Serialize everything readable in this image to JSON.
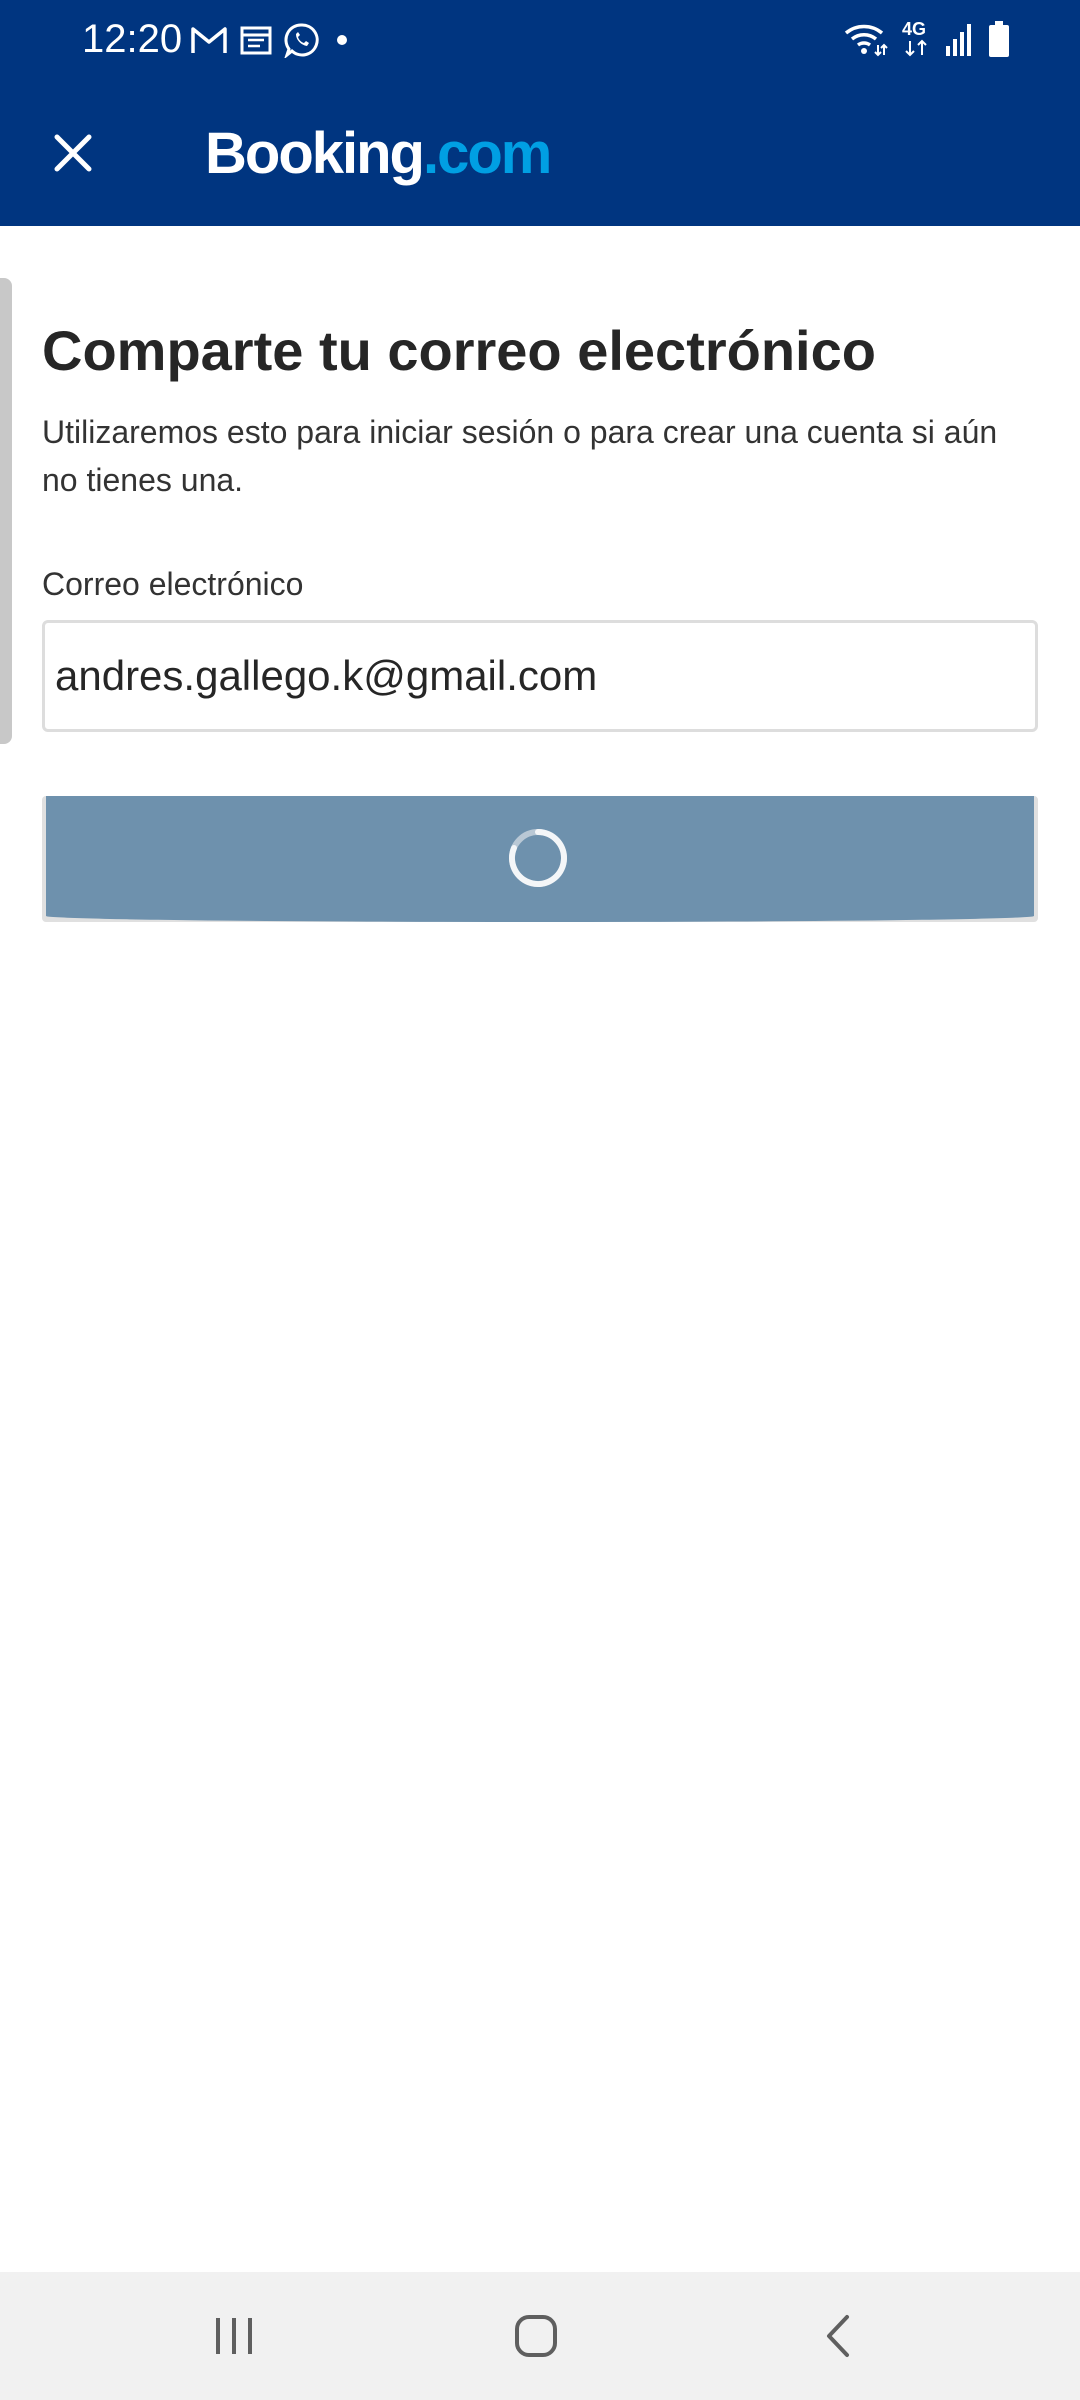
{
  "status_bar": {
    "time": "12:20",
    "left_icons": [
      "gmail-icon",
      "calendar-icon",
      "whatsapp-icon",
      "notification-dot-icon"
    ],
    "network_label": "4G",
    "right_icons": [
      "wifi-icon",
      "mobile-data-icon",
      "signal-icon",
      "battery-icon"
    ]
  },
  "app_bar": {
    "close_icon": "close-icon",
    "logo_main": "Booking",
    "logo_tld": ".com",
    "colors": {
      "background": "#003580",
      "logo_tld": "#009fe3"
    }
  },
  "main": {
    "title": "Comparte tu correo electrónico",
    "subtitle": "Utilizaremos esto para iniciar sesión o para crear una cuenta si aún no tienes una.",
    "email_label": "Correo electrónico",
    "email_value": "andres.gallego.k@gmail.com",
    "continue_button": {
      "state": "loading",
      "icon": "loading-spinner-icon",
      "color": "#6e91ad"
    }
  },
  "nav_bar": {
    "icons": [
      "recents-icon",
      "home-icon",
      "back-icon"
    ]
  }
}
